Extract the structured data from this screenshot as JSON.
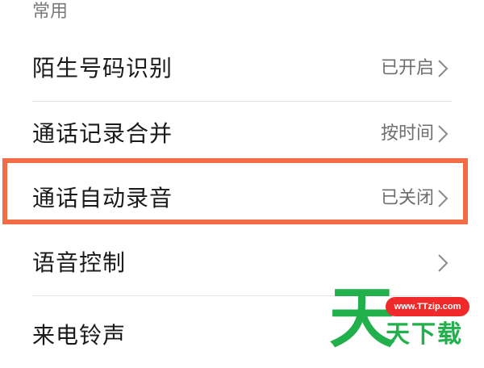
{
  "section": {
    "header": "常用"
  },
  "rows": [
    {
      "label": "陌生号码识别",
      "value": "已开启",
      "chevron_icon": "chevron-right-icon"
    },
    {
      "label": "通话记录合并",
      "value": "按时间",
      "chevron_icon": "chevron-right-icon"
    },
    {
      "label": "通话自动录音",
      "value": "已关闭",
      "chevron_icon": "chevron-right-icon"
    },
    {
      "label": "语音控制",
      "value": "",
      "chevron_icon": "chevron-right-icon"
    },
    {
      "label": "来电铃声",
      "value": "",
      "chevron_icon": ""
    }
  ],
  "highlight": {
    "color": "#f26d45",
    "target": "通话自动录音"
  },
  "watermark": {
    "url": "www.TTzip.com",
    "big_char": "天",
    "small_text": "天下载",
    "green": "#21b04b",
    "red": "#f02a2a"
  }
}
